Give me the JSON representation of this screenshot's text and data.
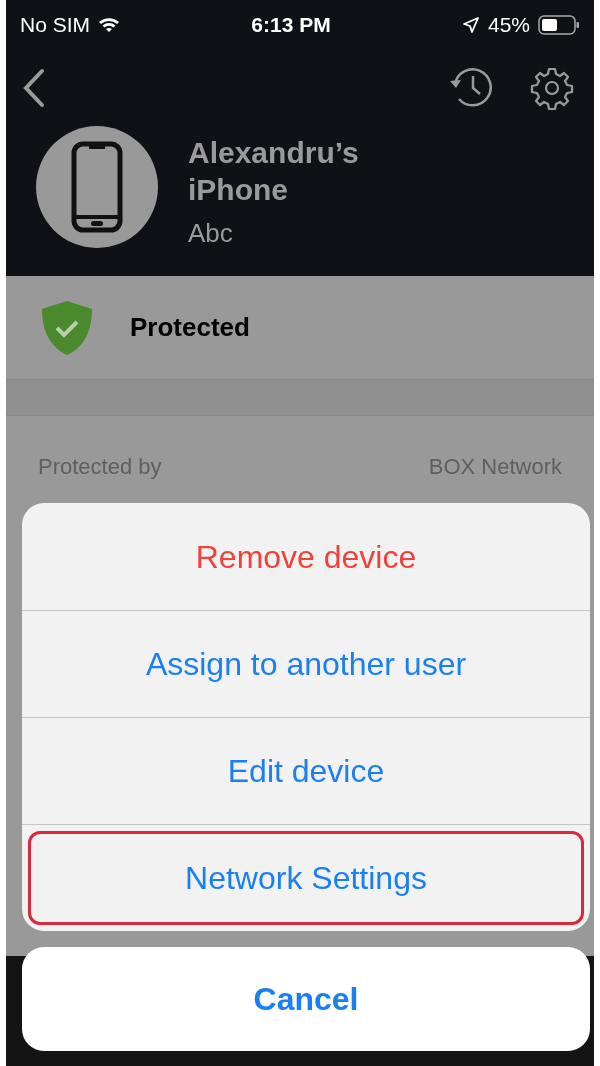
{
  "status_bar": {
    "carrier": "No SIM",
    "time": "6:13 PM",
    "battery": "45%"
  },
  "device": {
    "name": "Alexandru’s iPhone",
    "subtitle": "Abc"
  },
  "status": {
    "label": "Protected",
    "protected": true
  },
  "info": {
    "left_label": "Protected by",
    "right_label": "BOX Network"
  },
  "action_sheet": {
    "actions": [
      {
        "label": "Remove device",
        "kind": "destructive",
        "highlighted": false
      },
      {
        "label": "Assign to another user",
        "kind": "default",
        "highlighted": false
      },
      {
        "label": "Edit device",
        "kind": "default",
        "highlighted": false
      },
      {
        "label": "Network Settings",
        "kind": "default",
        "highlighted": true
      }
    ],
    "cancel": "Cancel"
  }
}
